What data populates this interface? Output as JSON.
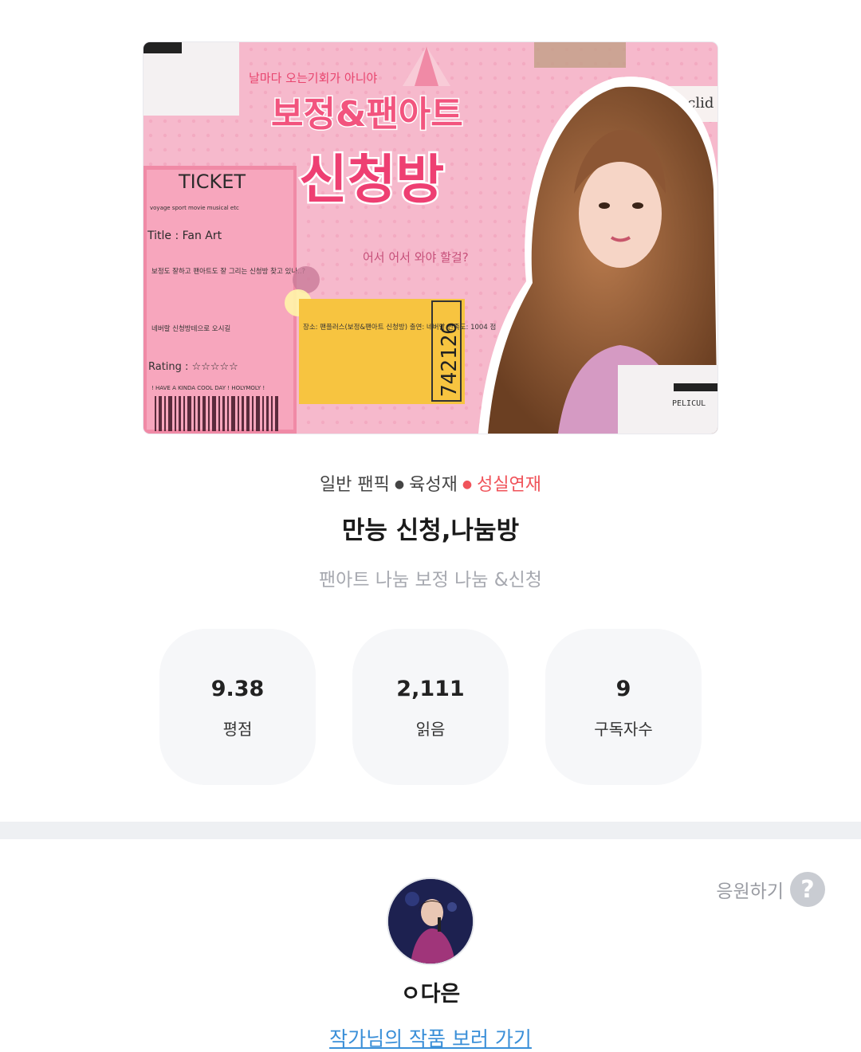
{
  "cover": {
    "headline_small": "날마다 오는기회가 아니야",
    "headline_1": "보정&팬아트",
    "headline_2": "신청방",
    "subline": "어서 어서 와야 할걸?",
    "ticket_title": "TICKET",
    "ticket_categories": "voyage  sport  movie  musical  etc",
    "ticket_film": "Title : Fan Art",
    "ticket_note": "보정도 잘하고 팬아트도 잘 그리는 신청방 찾고 있나..?",
    "ticket_note2": "네버랄 신청방테으로 오시길",
    "ticket_rating": "Rating : ☆☆☆☆☆",
    "ticket_footer": "! HAVE A KINDA COOL DAY ! HOLYMOLY !",
    "stub_text": "장소: 팬플러스(보정&팬아트 신청방) 출연: 네버랄 만족도: 1004 점",
    "stub_number": "742126",
    "tag_text": "euclid",
    "corner_text": "PELICUL"
  },
  "meta": {
    "genre": "일반 팬픽",
    "character": "육성재",
    "status": "성실연재",
    "status_color": "#f0535a"
  },
  "title": "만능 신청,나눔방",
  "description": "팬아트 나눔 보정 나눔 &신청",
  "stats": [
    {
      "value": "9.38",
      "label": "평점"
    },
    {
      "value": "2,111",
      "label": "읽음"
    },
    {
      "value": "9",
      "label": "구독자수"
    }
  ],
  "support": {
    "label": "응원하기",
    "icon": "question-icon"
  },
  "author": {
    "name": "ㅇ다은",
    "link": "작가님의 작품 보러 가기"
  }
}
